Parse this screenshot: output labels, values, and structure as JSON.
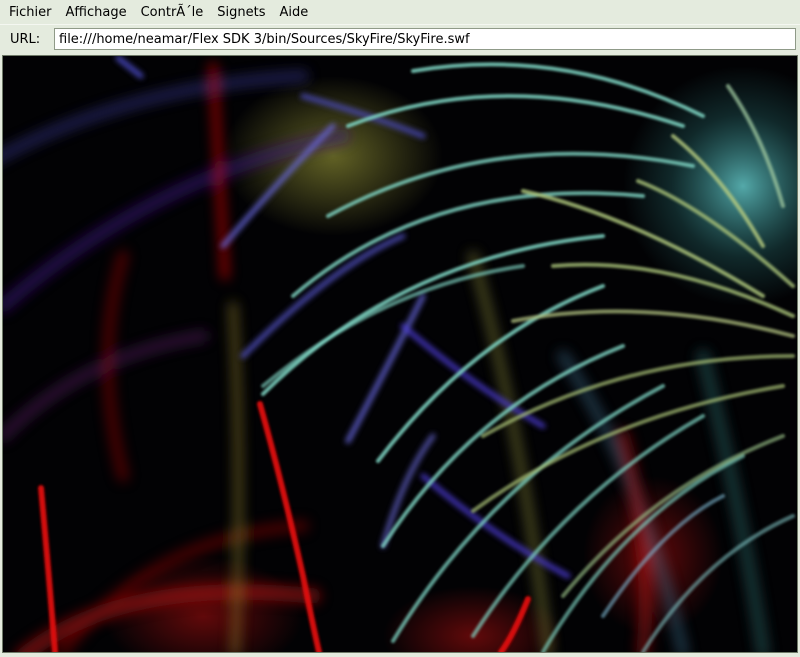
{
  "window": {
    "background": "#e4ebde"
  },
  "menubar": {
    "items": [
      {
        "label": "Fichier"
      },
      {
        "label": "Affichage"
      },
      {
        "label": "ContrÃ´le"
      },
      {
        "label": "Signets"
      },
      {
        "label": "Aide"
      }
    ]
  },
  "urlbar": {
    "label": "URL:",
    "value": "file:///home/neamar/Flex SDK 3/bin/Sources/SkyFire/SkyFire.swf"
  },
  "stage": {
    "content": "flash-fireworks-animation",
    "background": "#000000",
    "colors": {
      "red": "#e00a0a",
      "teal": "#7fd6c4",
      "blue": "#5a5ad0",
      "yellow_green": "#a8b060"
    }
  }
}
